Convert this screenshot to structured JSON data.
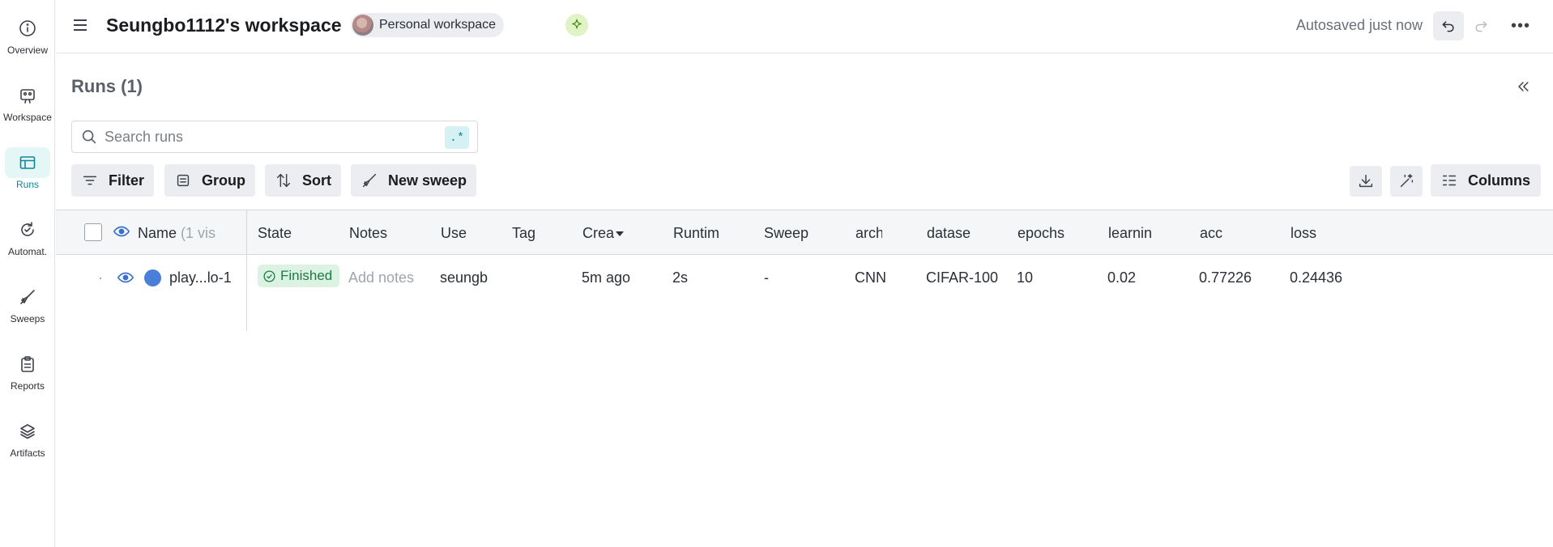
{
  "sidebar": {
    "items": [
      {
        "label": "Overview",
        "icon": "info-icon"
      },
      {
        "label": "Workspace",
        "icon": "workspace-icon"
      },
      {
        "label": "Runs",
        "icon": "table-icon",
        "active": true
      },
      {
        "label": "Automat.",
        "icon": "automation-icon"
      },
      {
        "label": "Sweeps",
        "icon": "broom-icon"
      },
      {
        "label": "Reports",
        "icon": "clipboard-icon"
      },
      {
        "label": "Artifacts",
        "icon": "layers-icon"
      }
    ]
  },
  "header": {
    "title": "Seungbo1112's workspace",
    "workspace_type": "Personal workspace",
    "autosave_status": "Autosaved just now"
  },
  "runs": {
    "title": "Runs (1)",
    "search_placeholder": "Search runs",
    "regex_label": ".*",
    "toolbar": {
      "filter": "Filter",
      "group": "Group",
      "sort": "Sort",
      "new_sweep": "New sweep",
      "columns": "Columns"
    },
    "columns": {
      "name": "Name",
      "name_hint": "(1 vis",
      "state": "State",
      "notes": "Notes",
      "user": "Use",
      "tags": "Tag",
      "created": "Crea",
      "runtime": "Runtim",
      "sweep": "Sweep",
      "arch": "arch",
      "dataset": "datase",
      "epochs": "epochs",
      "learning": "learnin",
      "acc": "acc",
      "loss": "loss"
    },
    "rows": [
      {
        "expander": "·",
        "name": "play...lo-1",
        "state": "Finished",
        "notes_placeholder": "Add notes",
        "user": "seungb",
        "tags": "",
        "created": "5m ago",
        "runtime": "2s",
        "sweep": "-",
        "arch": "CNN",
        "dataset": "CIFAR-100",
        "epochs": "10",
        "learning": "0.02",
        "acc": "0.77226",
        "loss": "0.24436",
        "color": "#4a7fd9"
      }
    ]
  },
  "colors": {
    "accent": "#0f8896",
    "finished_bg": "#dcf2e3",
    "finished_fg": "#1d7a43",
    "eye": "#3a6fc9"
  }
}
